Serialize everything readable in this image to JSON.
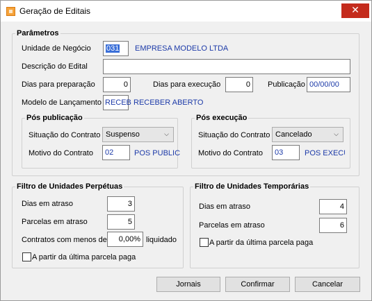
{
  "window": {
    "title": "Geração de Editais",
    "close_glyph": "✕",
    "icon": "app-icon"
  },
  "parametros": {
    "legend": "Parâmetros",
    "unidade_label": "Unidade de Negócio",
    "unidade_code": "031",
    "unidade_name": "EMPRESA MODELO LTDA",
    "descricao_label": "Descrição do Edital",
    "descricao_value": "",
    "dias_prep_label": "Dias para preparação",
    "dias_prep_value": "0",
    "dias_exec_label": "Dias para execução",
    "dias_exec_value": "0",
    "publicacao_label": "Publicação",
    "publicacao_value": "00/00/00",
    "modelo_label": "Modelo de Lançamento",
    "modelo_code": "RECEB",
    "modelo_name": "RECEBER ABERTO"
  },
  "pos_publicacao": {
    "legend": "Pós publicação",
    "situacao_label": "Situação do Contrato",
    "situacao_value": "Suspenso",
    "motivo_label": "Motivo do Contrato",
    "motivo_code": "02",
    "motivo_name": "POS PUBLIC"
  },
  "pos_execucao": {
    "legend": "Pós execução",
    "situacao_label": "Situação do Contrato",
    "situacao_value": "Cancelado",
    "motivo_label": "Motivo do Contrato",
    "motivo_code": "03",
    "motivo_name": "POS EXECU("
  },
  "filtro_perpetuas": {
    "legend": "Filtro de Unidades Perpétuas",
    "dias_atraso_label": "Dias em atraso",
    "dias_atraso_value": "3",
    "parcelas_label": "Parcelas em atraso",
    "parcelas_value": "5",
    "contratos_label": "Contratos com menos de",
    "contratos_value": "0,00%",
    "liquidado_label": "liquidado",
    "checkbox_label": "A partir da última parcela paga"
  },
  "filtro_temporarias": {
    "legend": "Filtro de Unidades Temporárias",
    "dias_atraso_label": "Dias em atraso",
    "dias_atraso_value": "4",
    "parcelas_label": "Parcelas em atraso",
    "parcelas_value": "6",
    "checkbox_label": "A partir da última parcela paga"
  },
  "buttons": {
    "jornais": "Jornais",
    "confirmar": "Confirmar",
    "cancelar": "Cancelar"
  }
}
